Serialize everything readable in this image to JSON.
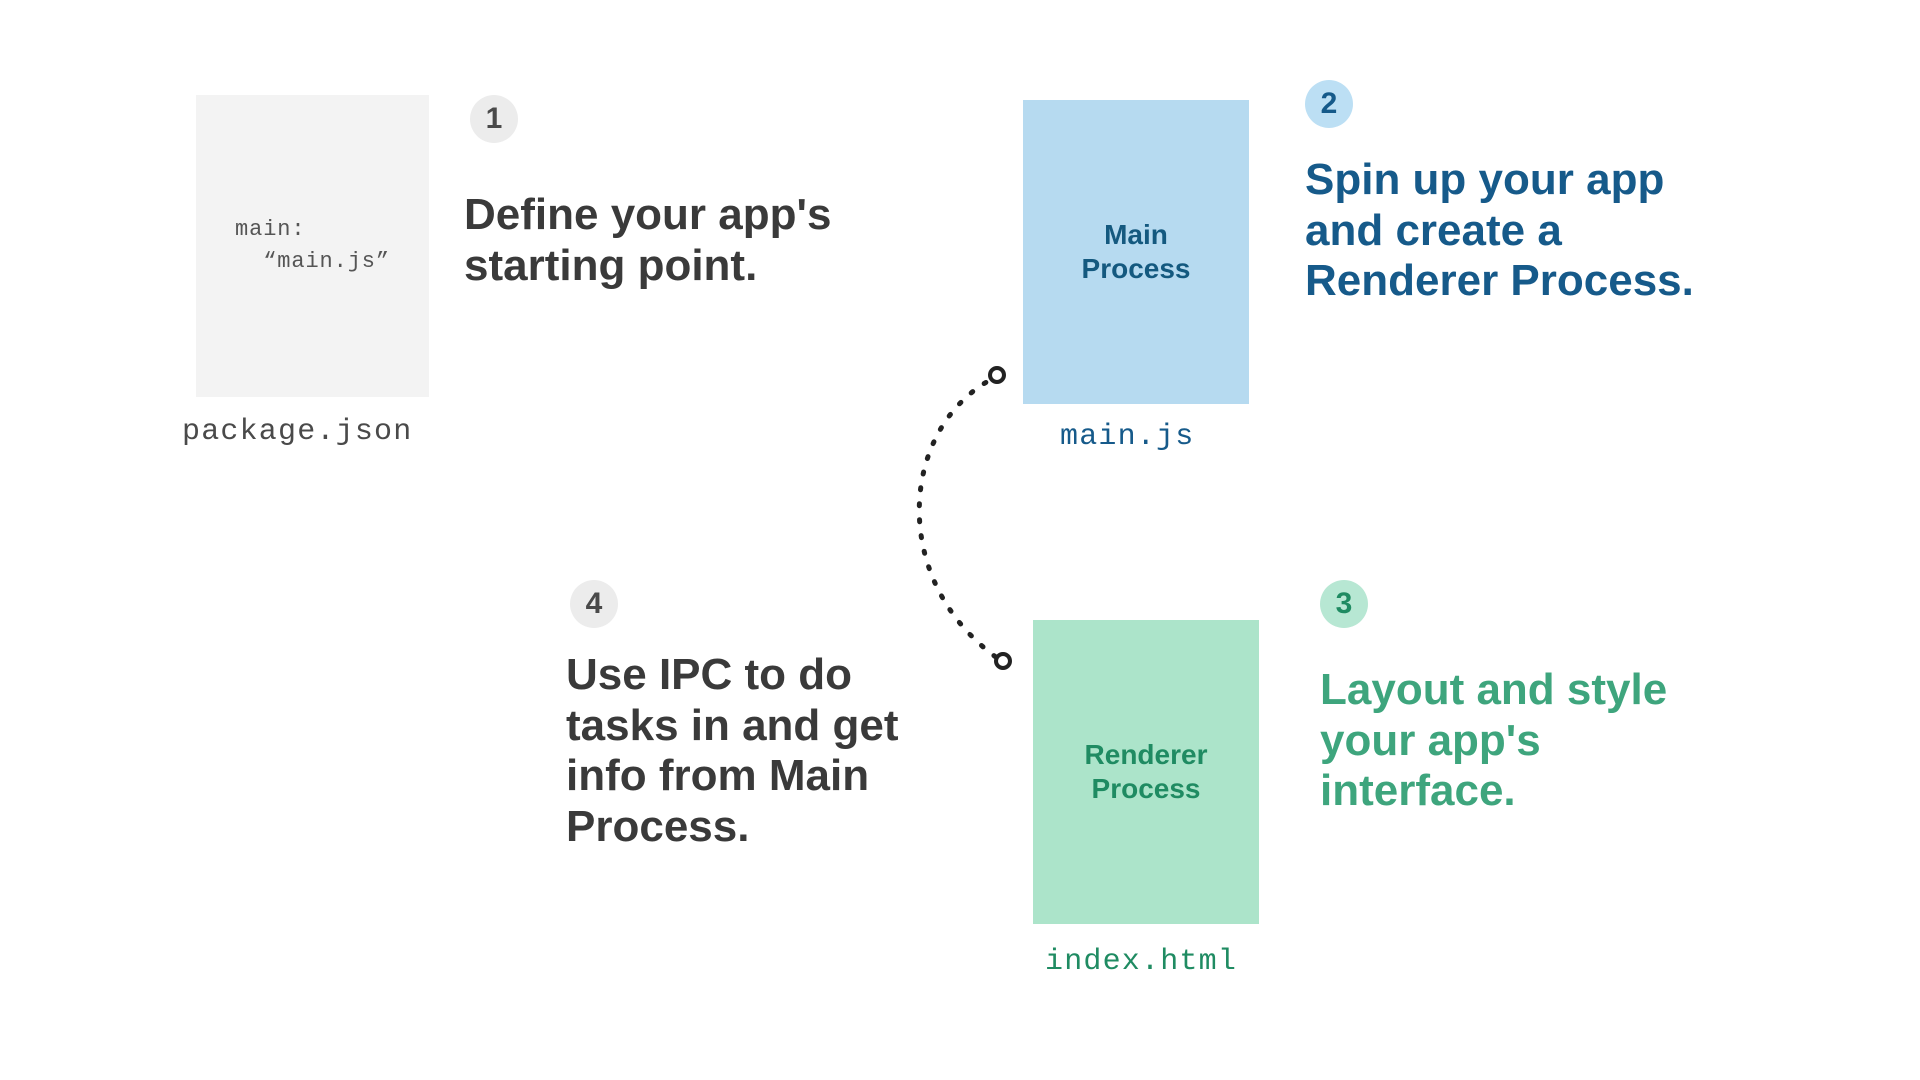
{
  "steps": {
    "one": {
      "num": "1",
      "heading": "Define your app's starting point."
    },
    "two": {
      "num": "2",
      "heading": "Spin up your app and create a Renderer Process."
    },
    "three": {
      "num": "3",
      "heading": "Layout and style your app's interface."
    },
    "four": {
      "num": "4",
      "heading": "Use IPC to do tasks in and get info from Main Process."
    }
  },
  "files": {
    "package": {
      "label": "package.json",
      "code": "main:\n  “main.js”"
    },
    "main": {
      "label": "main.js",
      "card_title": "Main\nProcess"
    },
    "renderer": {
      "label": "index.html",
      "card_title": "Renderer\nProcess"
    }
  },
  "colors": {
    "gray_bg": "#f3f3f3",
    "blue_bg": "#b6daf0",
    "green_bg": "#ace4ca",
    "blue_text": "#165a8a",
    "green_text": "#3ea57d"
  }
}
